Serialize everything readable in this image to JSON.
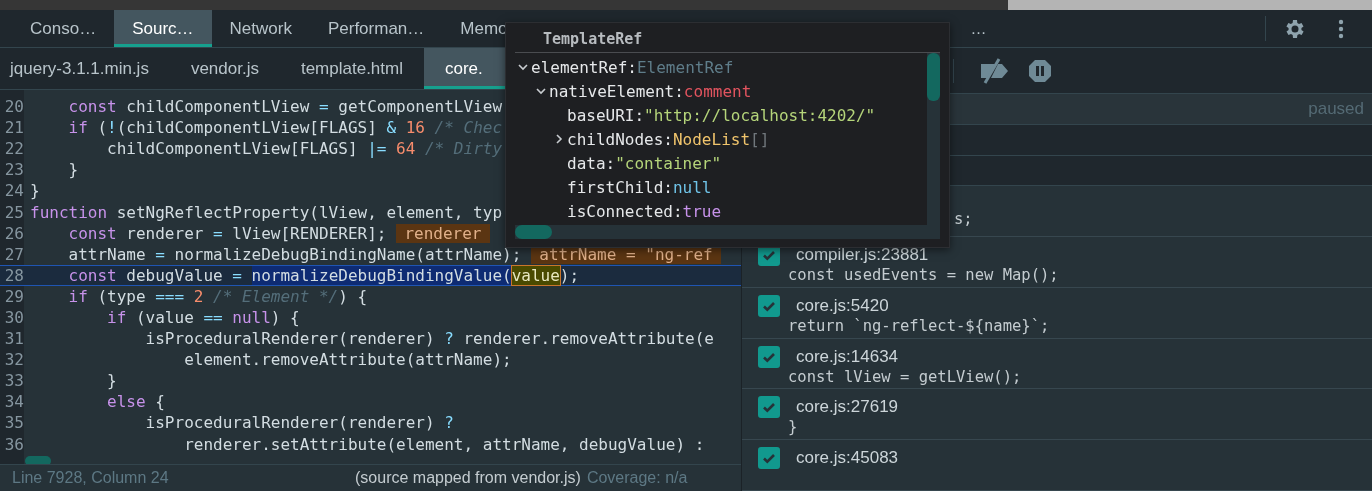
{
  "panel_tabs": [
    {
      "label": "Conso…",
      "selected": false
    },
    {
      "label": "Sourc…",
      "selected": true
    },
    {
      "label": "Network",
      "selected": false
    },
    {
      "label": "Performan…",
      "selected": false
    },
    {
      "label": "Memo",
      "selected": false
    }
  ],
  "panel_tabs_overflow": "…",
  "file_tabs": [
    {
      "label": "jquery-3.1.1.min.js",
      "selected": false
    },
    {
      "label": "vendor.js",
      "selected": false
    },
    {
      "label": "template.html",
      "selected": false
    },
    {
      "label": "core.",
      "selected": true
    }
  ],
  "code": {
    "lines": [
      {
        "n": "20",
        "current": false,
        "tokens": [
          {
            "text": "    const",
            "kind": "keyword"
          },
          {
            "text": " childComponentLView",
            "kind": "name"
          },
          {
            "text": " =",
            "kind": "operator"
          },
          {
            "text": " getComponentLView",
            "kind": "name"
          }
        ]
      },
      {
        "n": "21",
        "current": false,
        "tokens": [
          {
            "text": "    if",
            "kind": "keyword"
          },
          {
            "text": " (",
            "kind": "name"
          },
          {
            "text": "!",
            "kind": "operator"
          },
          {
            "text": "(childComponentLView[FLAGS]",
            "kind": "name"
          },
          {
            "text": " &",
            "kind": "operator"
          },
          {
            "text": " 16",
            "kind": "number"
          },
          {
            "text": " /* Chec",
            "kind": "comment"
          }
        ]
      },
      {
        "n": "22",
        "current": false,
        "tokens": [
          {
            "text": "        childComponentLView[FLAGS]",
            "kind": "name"
          },
          {
            "text": " |=",
            "kind": "operator"
          },
          {
            "text": " 64",
            "kind": "number"
          },
          {
            "text": " /* Dirty",
            "kind": "comment"
          }
        ]
      },
      {
        "n": "23",
        "current": false,
        "tokens": [
          {
            "text": "    }",
            "kind": "name"
          }
        ]
      },
      {
        "n": "24",
        "current": false,
        "tokens": [
          {
            "text": "}",
            "kind": "name"
          }
        ]
      },
      {
        "n": "25",
        "current": false,
        "tokens": [
          {
            "text": "function",
            "kind": "keyword"
          },
          {
            "text": " setNgReflectProperty(lView, element, typ",
            "kind": "name"
          }
        ]
      },
      {
        "n": "26",
        "current": false,
        "tokens": [
          {
            "text": "    const",
            "kind": "keyword"
          },
          {
            "text": " renderer",
            "kind": "name"
          },
          {
            "text": " =",
            "kind": "operator"
          },
          {
            "text": " lView[RENDERER];",
            "kind": "name"
          }
        ],
        "badge": "renderer"
      },
      {
        "n": "27",
        "current": false,
        "tokens": [
          {
            "text": "    attrName",
            "kind": "name"
          },
          {
            "text": " =",
            "kind": "operator"
          },
          {
            "text": " normalizeDebugBindingName(attrName);",
            "kind": "name"
          }
        ],
        "badge": "attrName = \"ng-ref"
      },
      {
        "n": "28",
        "current": true,
        "tokens": [
          {
            "text": "    const",
            "kind": "keyword"
          },
          {
            "text": " debugValue",
            "kind": "name"
          },
          {
            "text": " = ",
            "kind": "operator"
          },
          {
            "text": "normalizeDebugBindingValue(",
            "kind": "selection"
          },
          {
            "text": "value",
            "kind": "match"
          },
          {
            "text": ");",
            "kind": "name"
          }
        ]
      },
      {
        "n": "29",
        "current": false,
        "tokens": [
          {
            "text": "    if",
            "kind": "keyword"
          },
          {
            "text": " (type",
            "kind": "name"
          },
          {
            "text": " ===",
            "kind": "operator"
          },
          {
            "text": " 2",
            "kind": "number"
          },
          {
            "text": " /* Element */",
            "kind": "comment"
          },
          {
            "text": ") {",
            "kind": "name"
          }
        ]
      },
      {
        "n": "30",
        "current": false,
        "tokens": [
          {
            "text": "        if",
            "kind": "keyword"
          },
          {
            "text": " (value",
            "kind": "name"
          },
          {
            "text": " ==",
            "kind": "operator"
          },
          {
            "text": " null",
            "kind": "keyword"
          },
          {
            "text": ") {",
            "kind": "name"
          }
        ]
      },
      {
        "n": "31",
        "current": false,
        "tokens": [
          {
            "text": "            isProceduralRenderer(renderer)",
            "kind": "name"
          },
          {
            "text": " ?",
            "kind": "operator"
          },
          {
            "text": " renderer.removeAttribute(e",
            "kind": "name"
          }
        ]
      },
      {
        "n": "32",
        "current": false,
        "tokens": [
          {
            "text": "                element.removeAttribute(attrName);",
            "kind": "name"
          }
        ]
      },
      {
        "n": "33",
        "current": false,
        "tokens": [
          {
            "text": "        }",
            "kind": "name"
          }
        ]
      },
      {
        "n": "34",
        "current": false,
        "tokens": [
          {
            "text": "        else",
            "kind": "keyword"
          },
          {
            "text": " {",
            "kind": "name"
          }
        ]
      },
      {
        "n": "35",
        "current": false,
        "tokens": [
          {
            "text": "            isProceduralRenderer(renderer)",
            "kind": "name"
          },
          {
            "text": " ?",
            "kind": "operator"
          }
        ]
      },
      {
        "n": "36",
        "current": false,
        "tokens": [
          {
            "text": "                renderer.setAttribute(element, attrName, debugValue) :",
            "kind": "name"
          }
        ]
      }
    ]
  },
  "status_bar": {
    "position": "Line 7928, Column 24",
    "source": "(source mapped from vendor.js)",
    "coverage": "Coverage: n/a"
  },
  "debugger": {
    "status": "paused",
    "breakpoints": [
      {
        "kind": "partial",
        "code": "s;"
      },
      {
        "kind": "full",
        "file": "compiler.js:23881",
        "code": "const usedEvents = new Map();",
        "checked": true
      },
      {
        "kind": "full",
        "file": "core.js:5420",
        "code": "return `ng-reflect-${name}`;",
        "checked": true
      },
      {
        "kind": "full",
        "file": "core.js:14634",
        "code": "const lView = getLView();",
        "checked": true
      },
      {
        "kind": "full",
        "file": "core.js:27619",
        "code": "}",
        "checked": true
      },
      {
        "kind": "full",
        "file": "core.js:45083",
        "checked": true
      }
    ]
  },
  "popover": {
    "title": "TemplateRef",
    "tree": [
      {
        "key": "elementRef:",
        "value": "ElementRef",
        "kind": "type",
        "expanded": true,
        "children": [
          {
            "key": "nativeElement:",
            "value": "comment",
            "kind": "tag",
            "expanded": true,
            "children": [
              {
                "key": "baseURI:",
                "value": "\"http://localhost:4202/\"",
                "kind": "string"
              },
              {
                "key": "childNodes:",
                "value": "NodeList",
                "extra": "[]",
                "kind": "object",
                "expanded": false
              },
              {
                "key": "data:",
                "value": "\"container\"",
                "kind": "string"
              },
              {
                "key": "firstChild:",
                "value": "null",
                "kind": "null"
              },
              {
                "key": "isConnected:",
                "value": "true",
                "kind": "bool"
              }
            ]
          }
        ]
      }
    ]
  }
}
